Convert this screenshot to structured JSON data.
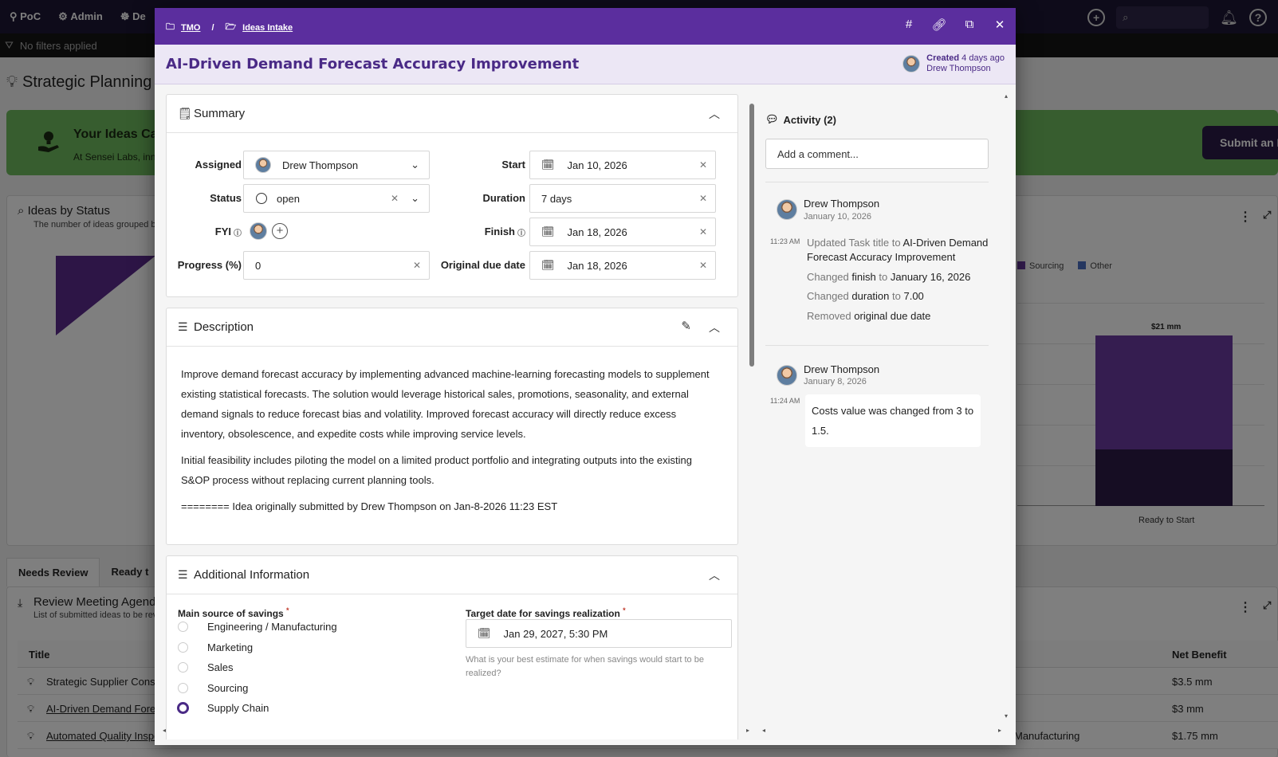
{
  "app": {
    "nav": [
      "PoC",
      "Admin",
      "De"
    ],
    "filters_text": "No filters applied",
    "page_title": "Strategic Planning",
    "banner": {
      "title": "Your Ideas Ca",
      "subtitle": "At Sensei Labs, inn"
    },
    "submit_label": "Submit an Id",
    "status_chart": {
      "title": "Ideas by Status",
      "subtitle": "The number of ideas grouped by"
    },
    "tabs": [
      "Needs Review",
      "Ready t"
    ],
    "review": {
      "title": "Review Meeting Agenda",
      "subtitle": "List of submitted ideas to be revi"
    },
    "table": {
      "headers": {
        "title": "Title",
        "net_benefit": "Net Benefit"
      },
      "rows": [
        {
          "title": "Strategic Supplier Consol",
          "mid": "",
          "net_benefit": "$3.5 mm"
        },
        {
          "title": "AI-Driven Demand Forec",
          "mid": "",
          "net_benefit": "$3 mm"
        },
        {
          "title": "Automated Quality Inspe",
          "mid": "Manufacturing",
          "net_benefit": "$1.75 mm"
        }
      ]
    }
  },
  "chart_data": {
    "type": "bar",
    "categories": [
      "Ready to Start"
    ],
    "series": [
      {
        "name": "Sourcing",
        "values": [
          21
        ]
      },
      {
        "name": "Other",
        "values": [
          7
        ]
      }
    ],
    "data_labels": [
      "$21 mm"
    ],
    "legend": [
      "Sourcing",
      "Other"
    ],
    "legend_position": "top-right",
    "colors": {
      "Sourcing": "#6b3aa0",
      "Other": "#4a6fc0",
      "stack_bottom": "#2d1a46"
    }
  },
  "modal": {
    "breadcrumb": [
      "TMO",
      "Ideas Intake"
    ],
    "title": "AI-Driven Demand Forecast Accuracy Improvement",
    "created_label": "Created",
    "created_ago": "4 days ago",
    "created_by": "Drew Thompson",
    "summary": {
      "title": "Summary",
      "assigned_label": "Assigned",
      "assigned": "Drew Thompson",
      "status_label": "Status",
      "status": "open",
      "fyi_label": "FYI",
      "progress_label": "Progress (%)",
      "progress": "0",
      "start_label": "Start",
      "start": "Jan 10, 2026",
      "duration_label": "Duration",
      "duration": "7 days",
      "finish_label": "Finish",
      "finish": "Jan 18, 2026",
      "original_due_label": "Original due date",
      "original_due": "Jan 18, 2026"
    },
    "description": {
      "title": "Description",
      "p1": "Improve demand forecast accuracy by implementing advanced machine-learning forecasting models to supplement existing statistical forecasts. The solution would leverage historical sales, promotions, seasonality, and external demand signals to reduce forecast bias and volatility. Improved forecast accuracy will directly reduce excess inventory, obsolescence, and expedite costs while improving service levels.",
      "p2": "Initial feasibility includes piloting the model on a limited product portfolio and integrating outputs into the existing S&OP process without replacing current planning tools.",
      "p3": "======== Idea originally submitted by Drew Thompson on Jan-8-2026 11:23 EST"
    },
    "additional": {
      "title": "Additional Information",
      "savings_label": "Main source of savings",
      "savings_options": [
        "Engineering / Manufacturing",
        "Marketing",
        "Sales",
        "Sourcing",
        "Supply Chain"
      ],
      "savings_selected": "Supply Chain",
      "target_label": "Target date for savings realization",
      "target_value": "Jan 29, 2027, 5:30 PM",
      "target_hint": "What is your best estimate for when savings would start to be realized?",
      "required_mark": "*"
    },
    "activity": {
      "title": "Activity (2)",
      "comment_placeholder": "Add a comment...",
      "entries": [
        {
          "name": "Drew Thompson",
          "date": "January 10, 2026",
          "time": "11:23 AM",
          "changes": [
            {
              "verb": "Updated Task title to",
              "value": "AI-Driven Demand Forecast Accuracy Improvement"
            },
            {
              "verb": "Changed",
              "field": "finish",
              "to": "to",
              "value": "January 16, 2026"
            },
            {
              "verb": "Changed",
              "field": "duration",
              "to": "to",
              "value": "7.00"
            },
            {
              "verb": "Removed",
              "field": "original due date"
            }
          ]
        },
        {
          "name": "Drew Thompson",
          "date": "January 8, 2026",
          "time": "11:24 AM",
          "comment": "Costs value was changed from 3 to 1.5."
        }
      ]
    }
  }
}
